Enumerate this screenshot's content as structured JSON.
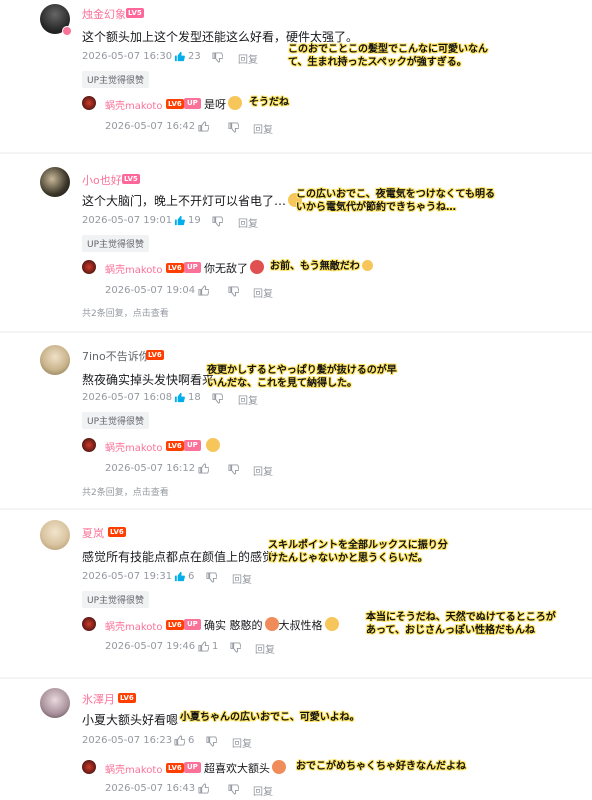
{
  "comments": [
    {
      "user": "烛金幻象",
      "user_color": "#fb7299",
      "level": "LV5",
      "text": "这个额头加上这个发型还能这么好看，硬件太强了。",
      "time": "2026-05-07 16:30",
      "likes": "23",
      "reply_label": "回复",
      "up_pick": "UP主觉得很赞",
      "annotation": "このおでことこの髪型でこんなに可愛いなんて、生まれ持ったスペックが強すぎる。",
      "replies": [
        {
          "user": "蜗壳makoto",
          "level": "LV6",
          "badge": "UP",
          "text": "是呀",
          "time": "2026-05-07 16:42",
          "reply_label": "回复",
          "annotation": "そうだね"
        }
      ]
    },
    {
      "user": "小o也好",
      "user_color": "#fb7299",
      "level": "LV5",
      "text": "这个大脑门，晚上不开灯可以省电了…",
      "time": "2026-05-07 19:01",
      "likes": "19",
      "reply_label": "回复",
      "up_pick": "UP主觉得很赞",
      "annotation": "この広いおでこ、夜電気をつけなくても明るいから電気代が節約できちゃうね…",
      "replies": [
        {
          "user": "蜗壳makoto",
          "level": "LV6",
          "badge": "UP",
          "text": "你无敌了",
          "time": "2026-05-07 19:04",
          "reply_label": "回复",
          "annotation": "お前、もう無敵だわ"
        }
      ],
      "more": "共2条回复，点击查看"
    },
    {
      "user": "7ino不告诉你",
      "user_color": "#61666d",
      "level": "LV6",
      "text": "熬夜确实掉头发快啊看来",
      "time": "2026-05-07 16:08",
      "likes": "18",
      "reply_label": "回复",
      "up_pick": "UP主觉得很赞",
      "annotation": "夜更かしするとやっぱり髪が抜けるのが早いんだな、これを見て納得した。",
      "replies": [
        {
          "user": "蜗壳makoto",
          "level": "LV6",
          "badge": "UP",
          "text": "",
          "time": "2026-05-07 16:12",
          "reply_label": "回复",
          "annotation": ""
        }
      ],
      "more": "共2条回复，点击查看"
    },
    {
      "user": "夏岚",
      "user_color": "#fb7299",
      "level": "LV6",
      "text": "感觉所有技能点都点在颜值上的感觉",
      "time": "2026-05-07 19:31",
      "likes": "6",
      "reply_label": "回复",
      "up_pick": "UP主觉得很赞",
      "annotation": "スキルポイントを全部ルックスに振り分けたんじゃないかと思うくらいだ。",
      "replies": [
        {
          "user": "蜗壳makoto",
          "level": "LV6",
          "badge": "UP",
          "text": "确实 憨憨的",
          "text2": "大叔性格",
          "time": "2026-05-07 19:46",
          "likes": "1",
          "reply_label": "回复",
          "annotation": "本当にそうだね、天然でぬけてるところがあって、おじさんっぽい性格だもんね"
        }
      ]
    },
    {
      "user": "氷澤月",
      "user_color": "#fb7299",
      "level": "LV6",
      "text": "小夏大额头好看嗯",
      "time": "2026-05-07 16:23",
      "likes": "6",
      "reply_label": "回复",
      "annotation": "小夏ちゃんの広いおでこ、可愛いよね。",
      "replies": [
        {
          "user": "蜗壳makoto",
          "level": "LV6",
          "badge": "UP",
          "text": "超喜欢大额头",
          "time": "2026-05-07 16:43",
          "reply_label": "回复",
          "annotation": "おでこがめちゃくちゃ好きなんだよね"
        }
      ]
    }
  ],
  "colors": {
    "pink": "#fb7299",
    "gray": "#9499a0",
    "like_blue": "#00aeec",
    "annotation_bg": "#ffe566"
  }
}
